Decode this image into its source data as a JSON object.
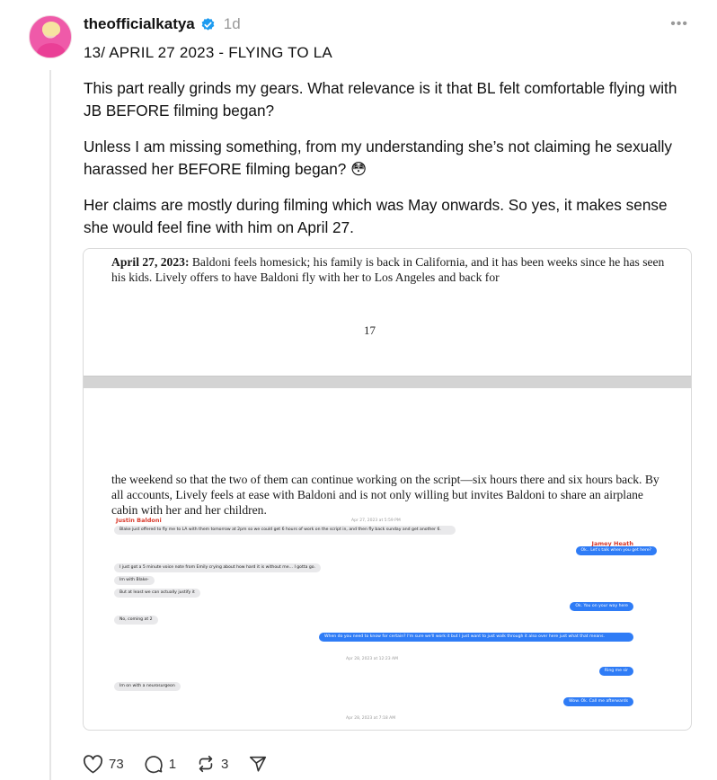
{
  "post": {
    "username": "theofficialkatya",
    "time": "1d",
    "more_label": "•••",
    "subtitle": "13/ APRIL 27 2023 - FLYING TO LA",
    "paragraphs": [
      "This part really grinds my gears. What relevance is it that BL felt comfortable flying with JB BEFORE filming began?",
      "Unless I am missing something, from my understanding she’s not claiming he sexually harassed her BEFORE filming began? 😳",
      "Her claims are mostly during filming which was May onwards. So yes, it makes sense she would feel fine with him on April 27."
    ]
  },
  "document": {
    "top_date": "April 27, 2023:",
    "top_text": " Baldoni feels homesick; his family is back in California, and it has been weeks since he has seen his kids. Lively offers to have Baldoni fly with her to Los Angeles and back for",
    "page_number": "17",
    "bottom_text": "the weekend so that the two of them can continue working on the script—six hours there and six hours back. By all accounts, Lively feels at ease with Baldoni and is not only willing but invites Baldoni to share an airplane cabin with her and her children."
  },
  "chat": {
    "left_name": "Justin Baldoni",
    "right_name": "Jamey Heath",
    "messages": [
      {
        "side": "ts",
        "text": "Apr 27, 2023 at 5:59 PM"
      },
      {
        "side": "left",
        "text": "Blake just offered to fly me to LA with them tomorrow at 2pm so we could get 6 hours of work on the script in, and then fly back sunday and get another 6."
      },
      {
        "side": "right",
        "text": "Ok.. Let's talk when you get here?"
      },
      {
        "side": "left",
        "text": "I just got a 5 minute voice note from Emily crying about how hard it is without me... I gotta go."
      },
      {
        "side": "left",
        "text": "Im with Blake-"
      },
      {
        "side": "left",
        "text": "But at least we can actually justify it"
      },
      {
        "side": "right",
        "text": "Ok. You on your way here"
      },
      {
        "side": "left",
        "text": "No, coming at 2"
      },
      {
        "side": "right",
        "text": "When do you need to know for certain? I'm sure we'll work it but I just want to just walk through it also over here just what that means."
      },
      {
        "side": "ts",
        "text": "Apr 28, 2023 at 12:23 AM"
      },
      {
        "side": "right",
        "text": "Ring me sir"
      },
      {
        "side": "left",
        "text": "Im on with a neurosurgeon"
      },
      {
        "side": "right",
        "text": "Wow. Ok. Call me afterwards"
      },
      {
        "side": "ts",
        "text": "Apr 28, 2023 at 7:18 AM"
      }
    ]
  },
  "actions": {
    "likes": "73",
    "replies": "1",
    "reposts": "3"
  },
  "colors": {
    "verified": "#1d9bf0",
    "imessage_blue": "#2f7cf6",
    "chat_name_red": "#d93a2b"
  }
}
